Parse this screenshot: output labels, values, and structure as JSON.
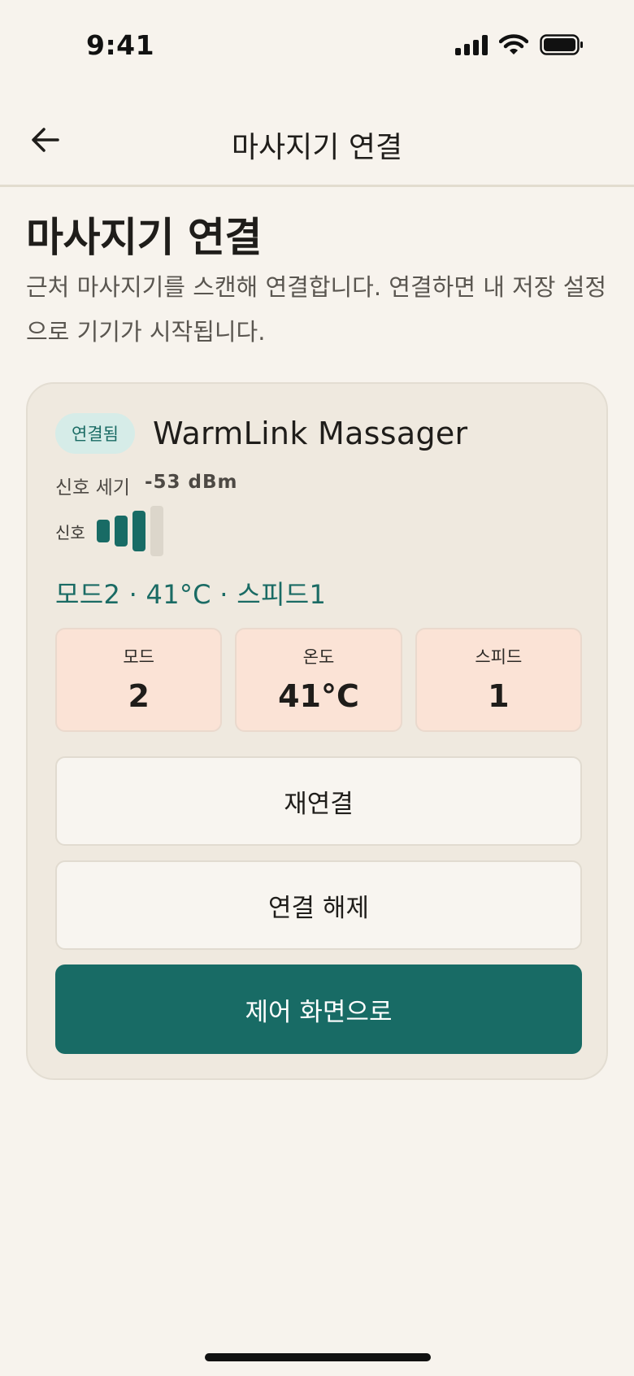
{
  "status_bar": {
    "time": "9:41",
    "icons": [
      "cellular-signal-icon",
      "wifi-icon",
      "battery-icon"
    ]
  },
  "header": {
    "back_icon": "arrow-left-icon",
    "title": "마사지기 연결"
  },
  "page": {
    "title": "마사지기 연결",
    "description": "근처 마사지기를 스캔해 연결합니다. 연결하면 내 저장 설정으로 기기가 시작됩니다."
  },
  "device": {
    "status_badge": "연결됨",
    "name": "WarmLink Massager",
    "rssi_label": "신호 세기",
    "rssi_value": "-53 dBm",
    "signal_label": "신호",
    "signal_bars_active": 3,
    "signal_bars_total": 4,
    "settings_summary": "모드2 · 41°C · 스피드1",
    "stats": [
      {
        "label": "모드",
        "value": "2"
      },
      {
        "label": "온도",
        "value": "41°C"
      },
      {
        "label": "스피드",
        "value": "1"
      }
    ]
  },
  "actions": {
    "reconnect": "재연결",
    "disconnect": "연결 해제",
    "control": "제어 화면으로"
  },
  "colors": {
    "background": "#f7f3ed",
    "card": "#efe9df",
    "accent": "#186b65",
    "badge_bg": "#d6ece8",
    "stat_tile": "#fbe3d6",
    "signal_inactive": "#dcd6cb"
  }
}
